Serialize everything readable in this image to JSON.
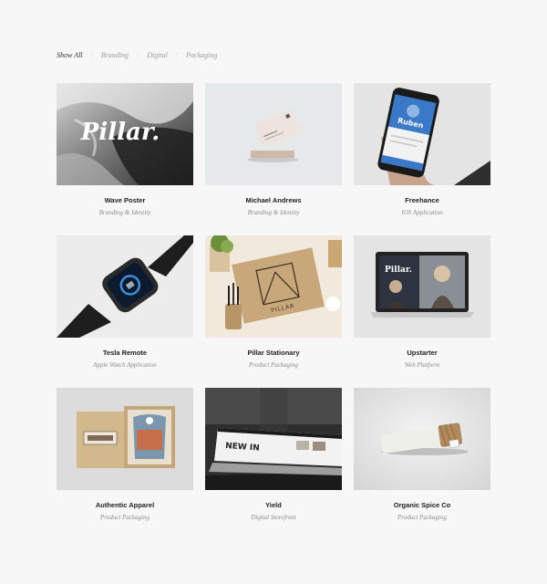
{
  "filters": [
    {
      "label": "Show All",
      "active": true
    },
    {
      "label": "Branding",
      "active": false
    },
    {
      "label": "Digital",
      "active": false
    },
    {
      "label": "Packaging",
      "active": false
    }
  ],
  "filter_separator": "/",
  "projects": [
    {
      "title": "Wave Poster",
      "category": "Branding & Identity",
      "image_text": "Pillar."
    },
    {
      "title": "Michael Andrews",
      "category": "Branding & Identity"
    },
    {
      "title": "Freehance",
      "category": "IOS Application",
      "image_text": "Ruben"
    },
    {
      "title": "Tesla Remote",
      "category": "Apple Watch Application"
    },
    {
      "title": "Pillar Stationary",
      "category": "Product Packaging",
      "image_text": "PILLAR"
    },
    {
      "title": "Upstarter",
      "category": "Web Platform",
      "image_text": "Pillar."
    },
    {
      "title": "Authentic Apparel",
      "category": "Product Packaging"
    },
    {
      "title": "Yield",
      "category": "Digital Storefront",
      "image_text": "NEW IN"
    },
    {
      "title": "Organic Spice Co",
      "category": "Product Packaging"
    }
  ]
}
